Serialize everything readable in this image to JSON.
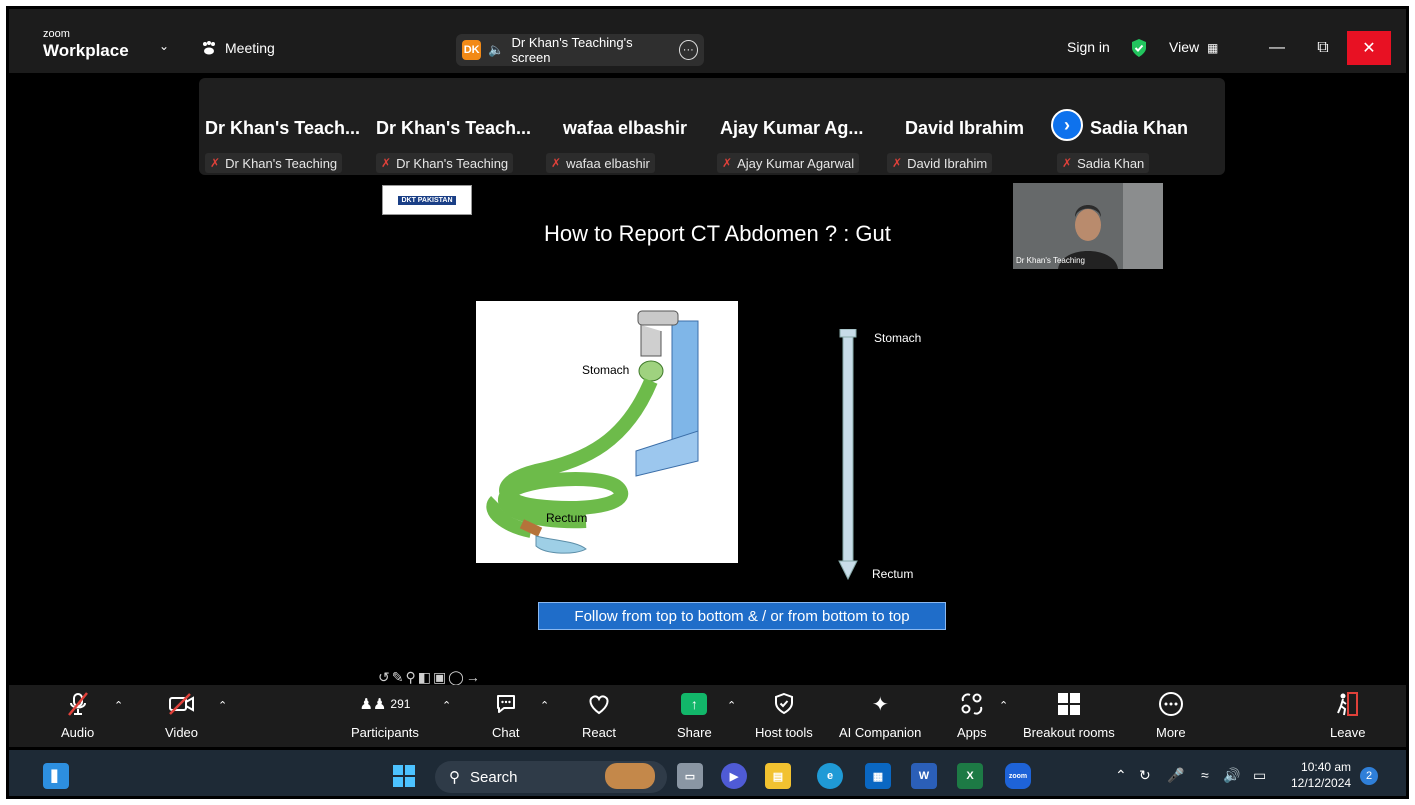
{
  "app": {
    "logo_small": "zoom",
    "logo_big": "Workplace",
    "meeting_label": "Meeting"
  },
  "screen_share": {
    "badge": "DK",
    "label": "Dr Khan's Teaching's screen"
  },
  "titlebar": {
    "sign_in": "Sign in",
    "view": "View"
  },
  "gallery": {
    "tiles": [
      {
        "name": "Dr Khan's Teach...",
        "tag": "Dr Khan's Teaching"
      },
      {
        "name": "Dr Khan's Teach...",
        "tag": "Dr Khan's Teaching"
      },
      {
        "name": "wafaa elbashir",
        "tag": "wafaa elbashir"
      },
      {
        "name": "Ajay Kumar Ag...",
        "tag": "Ajay Kumar Agarwal"
      },
      {
        "name": "David Ibrahim",
        "tag": "David Ibrahim"
      },
      {
        "name": "Sadia Khan",
        "tag": "Sadia Khan"
      }
    ]
  },
  "slide": {
    "logo_text": "DKT PAKISTAN",
    "title": "How to Report CT Abdomen ? : Gut",
    "pic_stomach": "Stomach",
    "pic_rectum": "Rectum",
    "arrow_top": "Stomach",
    "arrow_bottom": "Rectum",
    "caption": "Follow from top to bottom  & / or from bottom to top",
    "presenter_name": "Dr Khan's Teaching"
  },
  "controls": {
    "audio": "Audio",
    "video": "Video",
    "participants": "Participants",
    "participants_count": "291",
    "chat": "Chat",
    "react": "React",
    "share": "Share",
    "host_tools": "Host tools",
    "ai_companion": "AI Companion",
    "apps": "Apps",
    "breakout_rooms": "Breakout rooms",
    "more": "More",
    "leave": "Leave"
  },
  "taskbar": {
    "search": "Search",
    "time": "10:40 am",
    "date": "12/12/2024",
    "notifications": "2"
  },
  "colors": {
    "accent_blue": "#0e72ed",
    "share_green": "#12b76a",
    "leave_red": "#e0413a"
  }
}
